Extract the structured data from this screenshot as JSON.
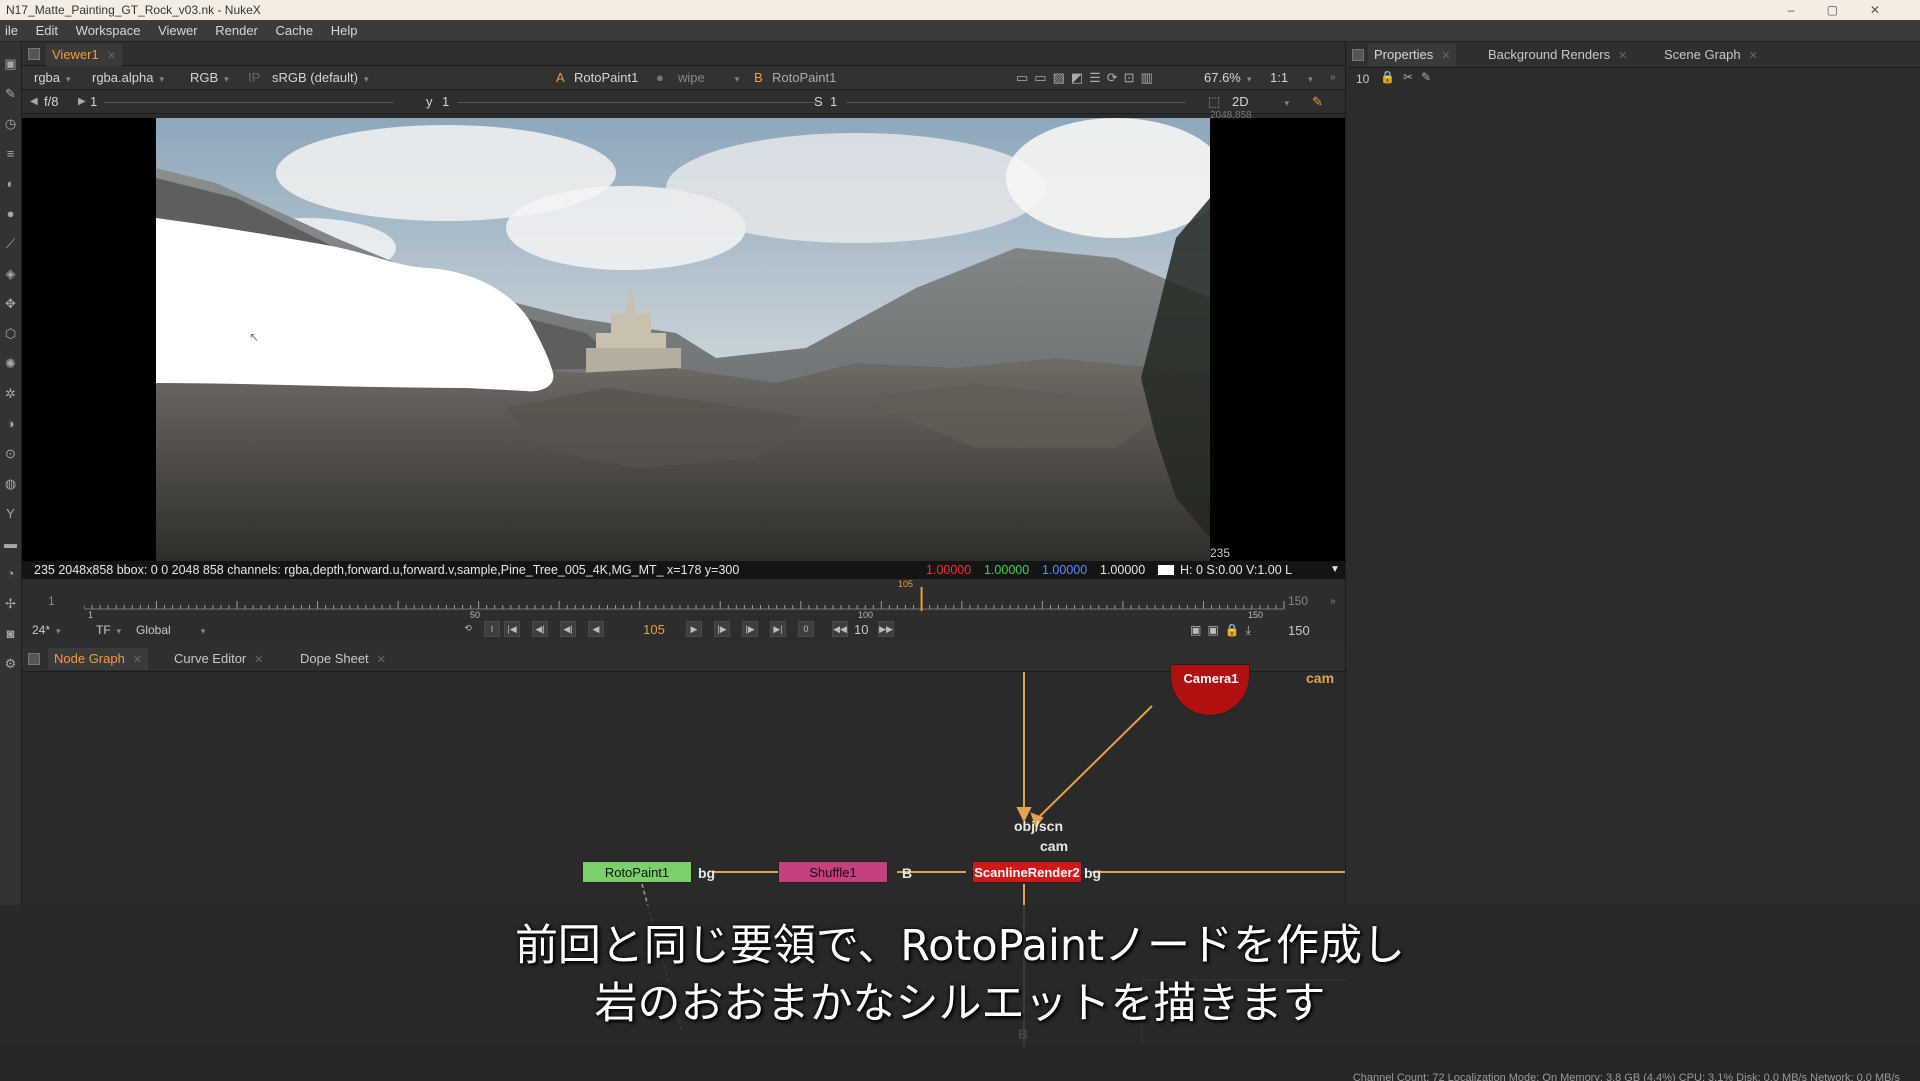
{
  "window": {
    "title": "N17_Matte_Painting_GT_Rock_v03.nk - NukeX"
  },
  "menu": [
    "ile",
    "Edit",
    "Workspace",
    "Viewer",
    "Render",
    "Cache",
    "Help"
  ],
  "viewer": {
    "tab": "Viewer1",
    "channels": "rgba",
    "alpha": "rgba.alpha",
    "colorspace_mode": "RGB",
    "ip": "IP",
    "lut": "sRGB (default)",
    "input_a_label": "A",
    "input_a": "RotoPaint1",
    "wipe": "wipe",
    "input_b_label": "B",
    "input_b": "RotoPaint1",
    "zoom": "67.6%",
    "ratio": "1:1",
    "fstop": "f/8",
    "gain": "1",
    "gamma_label": "y",
    "gamma": "1",
    "sat_label": "S",
    "sat": "1",
    "view_mode": "2D",
    "corner_top": "2048,858",
    "corner_bottom": "235",
    "info": {
      "main": "235 2048x858  bbox: 0 0 2048 858 channels: rgba,depth,forward.u,forward.v,sample,Pine_Tree_005_4K,MG_MT_  x=178 y=300",
      "r": "1.00000",
      "g": "1.00000",
      "b": "1.00000",
      "a": "1.00000",
      "extra": "H:  0 S:0.00 V:1.00  L"
    }
  },
  "timeline": {
    "start": "1",
    "end": "150",
    "tick_50": "50",
    "tick_100": "100",
    "tick_150": "150",
    "current_marker": "105",
    "current_frame": 105,
    "fps": "24*",
    "tf": "TF",
    "scope": "Global",
    "frame": "105",
    "step_zero": "0",
    "increment": "10",
    "out_frame": "150"
  },
  "node_panel": {
    "tabs": [
      "Node Graph",
      "Curve Editor",
      "Dope Sheet"
    ],
    "nodes": {
      "camera": "Camera1",
      "roto": "RotoPaint1",
      "shuffle": "Shuffle1",
      "scanline": "ScanlineRender2"
    },
    "labels": {
      "cam_out": "cam",
      "obj_scn": "obj/scn",
      "cam_in": "cam",
      "bg1": "bg",
      "b1": "B",
      "bg2": "bg",
      "b_bottom": "B"
    }
  },
  "properties": {
    "tabs": [
      "Properties",
      "Background Renders",
      "Scene Graph"
    ],
    "max_panels": "10"
  },
  "subtitle": {
    "line1": "前回と同じ要領で、RotoPaintノードを作成し",
    "line2": "岩のおおまかなシルエットを描きます"
  },
  "status": "Channel Count: 72  Localization Mode: On  Memory: 3.8 GB (4.4%)  CPU: 3.1%  Disk: 0.0 MB/s  Network: 0.0 MB/s",
  "colors": {
    "accent": "#f39c3a",
    "roto_node": "#7bd06c",
    "shuffle_node": "#c7407e",
    "scanline_node": "#d01818",
    "camera_node": "#b01010",
    "wire": "#e6a14a"
  }
}
